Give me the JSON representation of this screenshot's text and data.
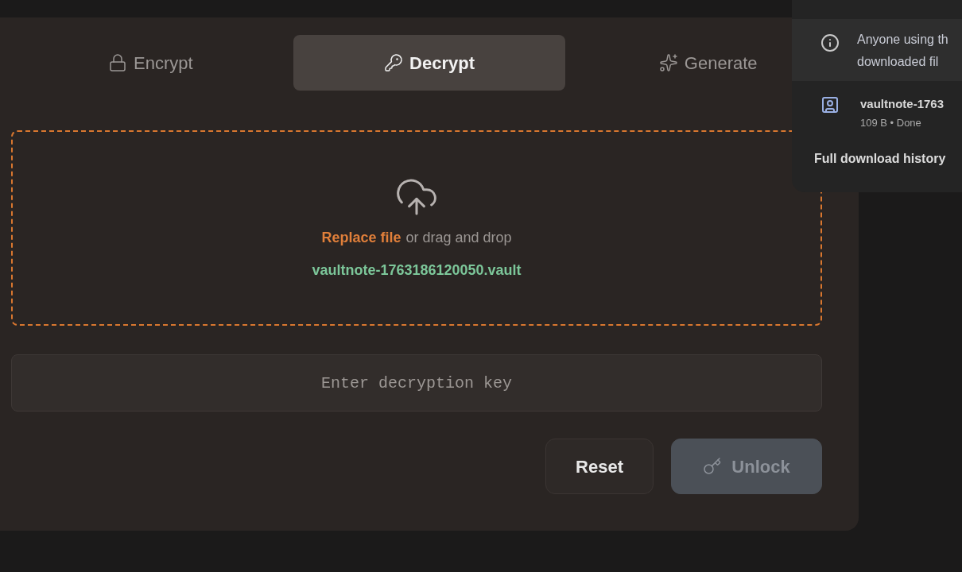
{
  "tabs": [
    {
      "label": "Encrypt",
      "kind": "lock",
      "selected": false
    },
    {
      "label": "Decrypt",
      "kind": "key",
      "selected": true
    },
    {
      "label": "Generate",
      "kind": "sparkles",
      "selected": false
    }
  ],
  "dropzone": {
    "link": "Replace file",
    "text": "or drag and drop",
    "file": "vaultnote-1763186120050.vault"
  },
  "key_field": {
    "placeholder": "Enter decryption key"
  },
  "buttons": [
    {
      "label": "Reset",
      "kind": "secondary",
      "disabled": false
    },
    {
      "label": "Unlock",
      "kind": "primary",
      "disabled": true
    }
  ],
  "downloads_popup": {
    "notice": [
      "Anyone using th",
      "downloaded fil"
    ],
    "items": [
      {
        "name": "vaultnote-1763",
        "status": "109 B • Done"
      }
    ],
    "footer": "Full download history"
  }
}
